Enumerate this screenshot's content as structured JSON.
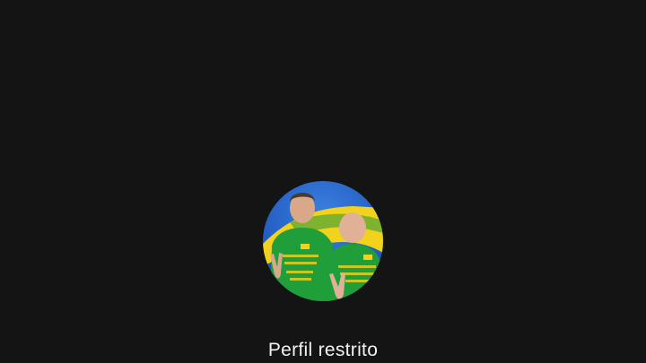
{
  "profile": {
    "status_label": "Perfil restrito",
    "avatar_icon": "profile-photo-icon",
    "colors": {
      "background": "#141414",
      "label": "#f2f2f2",
      "sky": "#1d5fcf",
      "flag_yellow": "#f2d21c",
      "shirt_green": "#1f9e3a"
    }
  }
}
